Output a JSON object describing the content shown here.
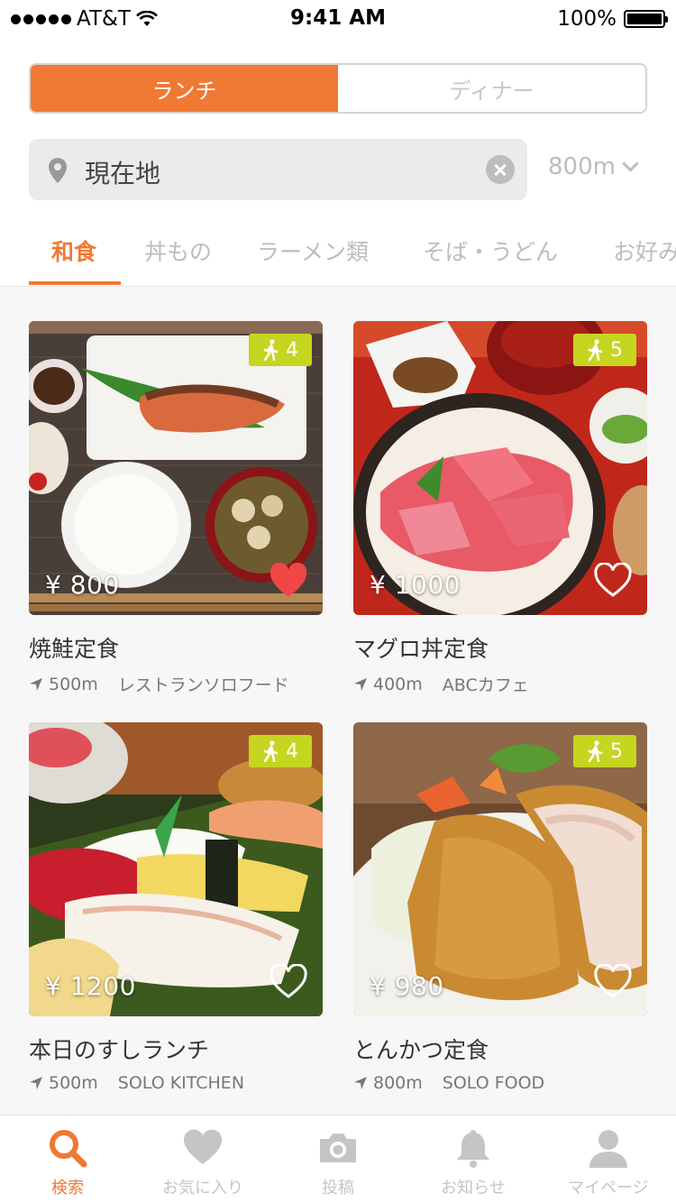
{
  "status_bar": {
    "carrier": "AT&T",
    "time": "9:41 AM",
    "battery": "100%"
  },
  "meal_toggle": {
    "options": [
      "ランチ",
      "ディナー"
    ],
    "selected": "ランチ"
  },
  "search": {
    "value": "現在地",
    "distance": "800m"
  },
  "categories": {
    "items": [
      "和食",
      "丼もの",
      "ラーメン類",
      "そば・うどん",
      "お好み"
    ],
    "selected": "和食"
  },
  "cards": [
    {
      "name": "焼鮭定食",
      "price": "¥ 800",
      "walk_minutes": "4",
      "distance": "500m",
      "shop": "レストランソロフード",
      "favorited": true
    },
    {
      "name": "マグロ丼定食",
      "price": "¥ 1000",
      "walk_minutes": "5",
      "distance": "400m",
      "shop": "ABCカフェ",
      "favorited": false
    },
    {
      "name": "本日のすしランチ",
      "price": "¥ 1200",
      "walk_minutes": "4",
      "distance": "500m",
      "shop": "SOLO KITCHEN",
      "favorited": false
    },
    {
      "name": "とんかつ定食",
      "price": "¥ 980",
      "walk_minutes": "5",
      "distance": "800m",
      "shop": "SOLO FOOD",
      "favorited": false
    }
  ],
  "bottom_nav": {
    "items": [
      "検索",
      "お気に入り",
      "投稿",
      "お知らせ",
      "マイページ"
    ],
    "active": "検索"
  },
  "colors": {
    "accent": "#f07934",
    "walk_badge": "#c6d51f",
    "favorite": "#f04646"
  }
}
